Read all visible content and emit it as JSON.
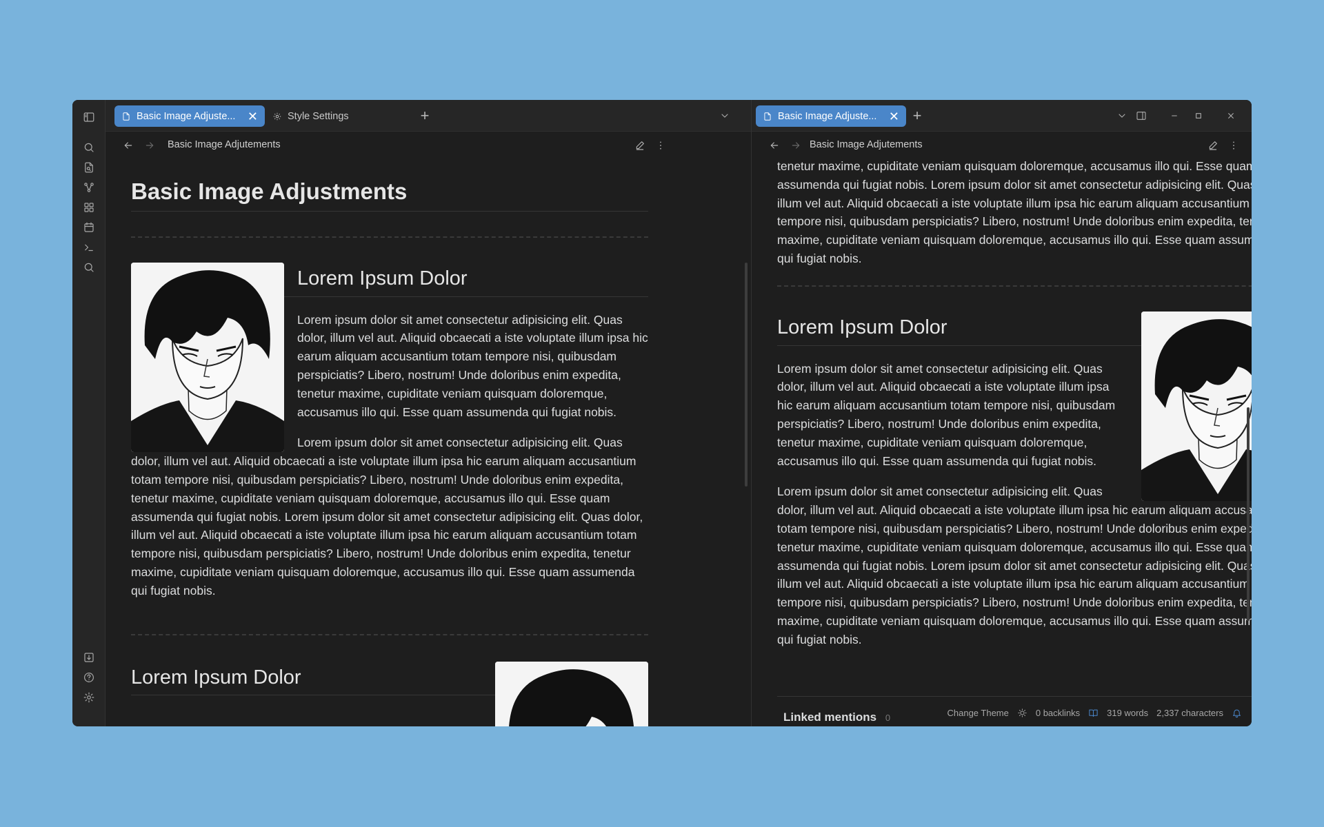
{
  "left_pane": {
    "tabs": [
      {
        "label": "Basic Image Adjuste...",
        "close": "✕"
      },
      {
        "label": "Style Settings"
      }
    ],
    "tab_add": "+",
    "view_title": "Basic Image Adjutements",
    "doc": {
      "title": "Basic Image Adjustments",
      "section1_heading": "Lorem Ipsum Dolor",
      "section1_p1": "Lorem ipsum dolor sit amet consectetur adipisicing elit. Quas dolor, illum vel aut. Aliquid obcaecati a iste voluptate illum ipsa hic earum aliquam accusantium totam tempore nisi, quibusdam perspiciatis? Libero, nostrum! Unde doloribus enim expedita, tenetur maxime, cupiditate veniam quisquam doloremque, accusamus illo qui. Esse quam assumenda qui fugiat nobis.",
      "section1_p2": "Lorem ipsum dolor sit amet consectetur adipisicing elit. Quas dolor, illum vel aut. Aliquid obcaecati a iste voluptate illum ipsa hic earum aliquam accusantium totam tempore nisi, quibusdam perspiciatis? Libero, nostrum! Unde doloribus enim expedita, tenetur maxime, cupiditate veniam quisquam doloremque, accusamus illo qui. Esse quam assumenda qui fugiat nobis. Lorem ipsum dolor sit amet consectetur adipisicing elit. Quas dolor, illum vel aut. Aliquid obcaecati a iste voluptate illum ipsa hic earum aliquam accusantium totam tempore nisi, quibusdam perspiciatis? Libero, nostrum! Unde doloribus enim expedita, tenetur maxime, cupiditate veniam quisquam doloremque, accusamus illo qui. Esse quam assumenda qui fugiat nobis.",
      "section2_heading": "Lorem Ipsum Dolor"
    }
  },
  "right_pane": {
    "tabs": [
      {
        "label": "Basic Image Adjuste...",
        "close": "✕"
      }
    ],
    "tab_add": "+",
    "view_title": "Basic Image Adjutements",
    "doc": {
      "top_text": "tenetur maxime, cupiditate veniam quisquam doloremque, accusamus illo qui. Esse quam assumenda qui fugiat nobis. Lorem ipsum dolor sit amet consectetur adipisicing elit. Quas dolor, illum vel aut. Aliquid obcaecati a iste voluptate illum ipsa hic earum aliquam accusantium totam tempore nisi, quibusdam perspiciatis? Libero, nostrum! Unde doloribus enim expedita, tenetur maxime, cupiditate veniam quisquam doloremque, accusamus illo qui. Esse quam assumenda qui fugiat nobis.",
      "section_heading": "Lorem Ipsum Dolor",
      "p1": "Lorem ipsum dolor sit amet consectetur adipisicing elit. Quas dolor, illum vel aut. Aliquid obcaecati a iste voluptate illum ipsa hic earum aliquam accusantium totam tempore nisi, quibusdam perspiciatis? Libero, nostrum! Unde doloribus enim expedita, tenetur maxime, cupiditate veniam quisquam doloremque, accusamus illo qui. Esse quam assumenda qui fugiat nobis.",
      "p2": "Lorem ipsum dolor sit amet consectetur adipisicing elit. Quas dolor, illum vel aut. Aliquid obcaecati a iste voluptate illum ipsa hic earum aliquam accusantium totam tempore nisi, quibusdam perspiciatis? Libero, nostrum! Unde doloribus enim expedita, tenetur maxime, cupiditate veniam quisquam doloremque, accusamus illo qui. Esse quam assumenda qui fugiat nobis. Lorem ipsum dolor sit amet consectetur adipisicing elit. Quas dolor, illum vel aut. Aliquid obcaecati a iste voluptate illum ipsa hic earum aliquam accusantium totam tempore nisi, quibusdam perspiciatis? Libero, nostrum! Unde doloribus enim expedita, tenetur maxime, cupiditate veniam quisquam doloremque, accusamus illo qui. Esse quam assumenda qui fugiat nobis."
    },
    "linked_mentions": {
      "label": "Linked mentions",
      "count": "0"
    }
  },
  "status_bar": {
    "change_theme": "Change Theme",
    "backlinks": "0 backlinks",
    "words": "319 words",
    "characters": "2,337 characters"
  },
  "colors": {
    "accent": "#4a86c9",
    "background": "#79b3dc",
    "editor": "#1e1e1e",
    "notification": "#4a86c9"
  }
}
